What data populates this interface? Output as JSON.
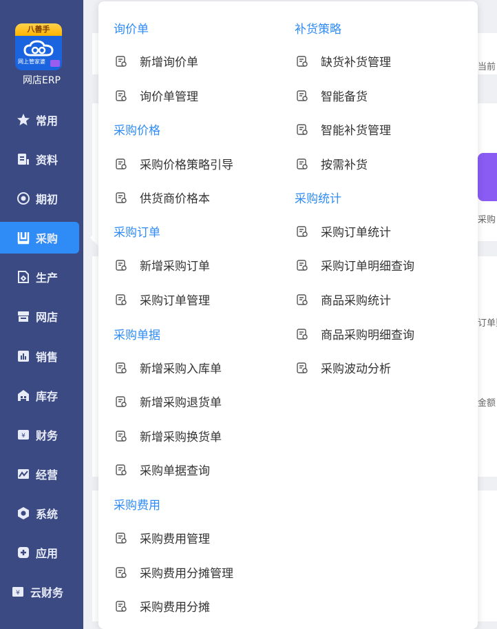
{
  "brand": {
    "logo_top": "八善手",
    "logo_sub": "网上管家婆",
    "name": "网店ERP"
  },
  "sidebar": [
    {
      "label": "常用",
      "icon": "star-icon"
    },
    {
      "label": "资料",
      "icon": "document-icon"
    },
    {
      "label": "期初",
      "icon": "target-icon"
    },
    {
      "label": "采购",
      "icon": "purchase-icon",
      "active": true
    },
    {
      "label": "生产",
      "icon": "production-icon"
    },
    {
      "label": "网店",
      "icon": "store-icon"
    },
    {
      "label": "销售",
      "icon": "chart-icon"
    },
    {
      "label": "库存",
      "icon": "warehouse-icon"
    },
    {
      "label": "财务",
      "icon": "yen-icon"
    },
    {
      "label": "经营",
      "icon": "trend-icon"
    },
    {
      "label": "系统",
      "icon": "hexagon-icon"
    },
    {
      "label": "应用",
      "icon": "plus-icon"
    },
    {
      "label": "云财务",
      "icon": "cloud-finance-icon"
    }
  ],
  "background": {
    "t1": "当前",
    "t2": "采购",
    "t3": "订单数",
    "t4": "金额"
  },
  "menu": {
    "left": [
      {
        "heading": "询价单",
        "items": [
          "新增询价单",
          "询价单管理"
        ]
      },
      {
        "heading": "采购价格",
        "items": [
          "采购价格策略引导",
          "供货商价格本"
        ]
      },
      {
        "heading": "采购订单",
        "items": [
          "新增采购订单",
          "采购订单管理"
        ]
      },
      {
        "heading": "采购单据",
        "items": [
          "新增采购入库单",
          "新增采购退货单",
          "新增采购换货单",
          "采购单据查询"
        ]
      },
      {
        "heading": "采购费用",
        "items": [
          "采购费用管理",
          "采购费用分摊管理",
          "采购费用分摊"
        ]
      }
    ],
    "right": [
      {
        "heading": "补货策略",
        "items": [
          "缺货补货管理",
          "智能备货",
          "智能补货管理",
          "按需补货"
        ]
      },
      {
        "heading": "采购统计",
        "items": [
          "采购订单统计",
          "采购订单明细查询",
          "商品采购统计",
          "商品采购明细查询",
          "采购波动分析"
        ]
      }
    ]
  },
  "colors": {
    "sidebar": "#3b4a82",
    "active": "#2f8bf5",
    "heading": "#2f8bf5"
  }
}
